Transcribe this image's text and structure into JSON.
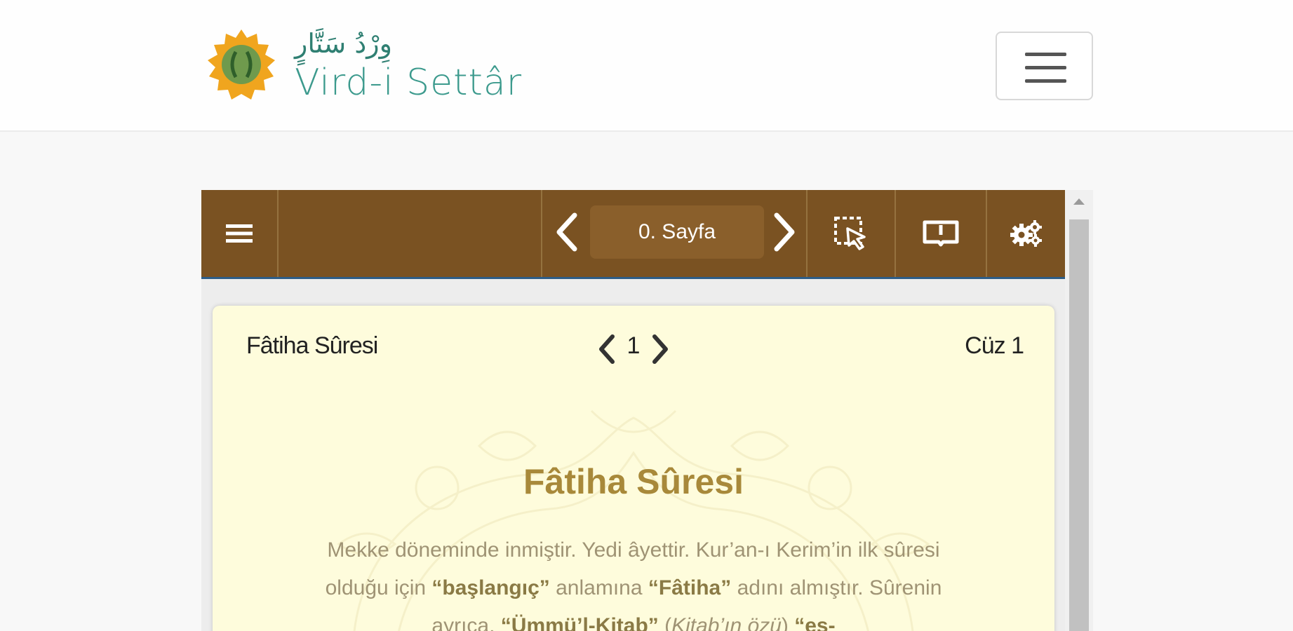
{
  "site": {
    "logo_arabic": "وِرْدُ سَتَّارٍ",
    "logo_latin": "Vird-i Settâr"
  },
  "toolbar": {
    "page_label": "0. Sayfa"
  },
  "page": {
    "sura_name": "Fâtiha Sûresi",
    "sura_number": "1",
    "juz_label": "Cüz 1",
    "title": "Fâtiha Sûresi",
    "intro": {
      "t1": "Mekke döneminde inmiştir. Yedi âyettir. Kur’an-ı Kerim’in ilk sûresi olduğu için ",
      "b1": "“başlangıç”",
      "t2": " anlamına ",
      "b2": "“Fâtiha”",
      "t3": " adını almıştır. Sûrenin ayrıca, ",
      "b3": "“Ümmü’l-Kitab”",
      "t4": " (",
      "i1": "Kitab’ın özü",
      "t5": ") ",
      "b4": "“es-"
    }
  },
  "colors": {
    "toolbar_bg": "#7a5222",
    "toolbar_border": "#2e5d87",
    "page_bg": "#fefcdc",
    "title": "#a8893a",
    "logo_teal": "#3c9a8d",
    "logo_gold": "#f0a51e"
  },
  "icons": {
    "toolbar_menu": "bars-icon",
    "prev_page": "chevron-left-icon",
    "next_page": "chevron-right-icon",
    "select": "select-cursor-icon",
    "book": "open-book-icon",
    "settings": "cogs-icon"
  }
}
